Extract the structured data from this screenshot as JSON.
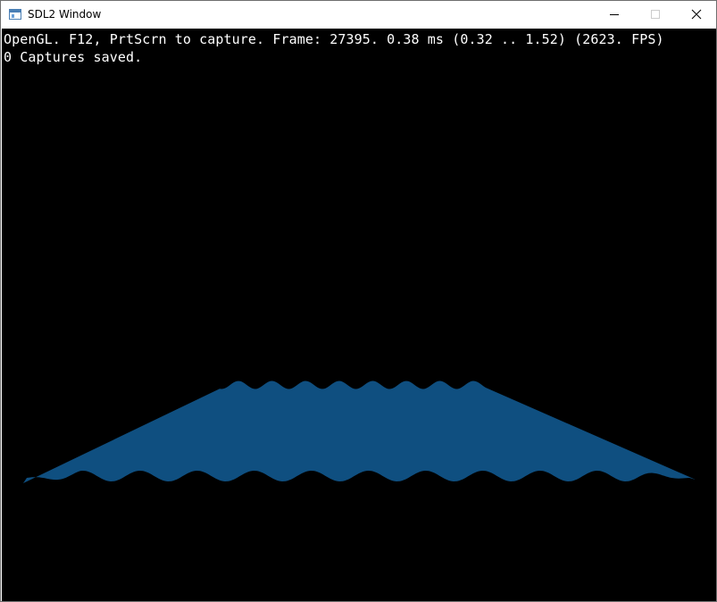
{
  "window": {
    "title": "SDL2 Window",
    "app_icon": "window-app-icon",
    "controls": {
      "minimize_icon": "minimize-icon",
      "maximize_icon": "maximize-icon",
      "close_icon": "close-icon"
    }
  },
  "overlay": {
    "status_line": "OpenGL. F12, PrtScrn to capture. Frame: 27395. 0.38 ms (0.32 .. 1.52) (2623. FPS)",
    "captures_line": "0 Captures saved."
  },
  "colors": {
    "canvas_background": "#000000",
    "shape_fill": "#0f4f80",
    "overlay_text": "#ffffff"
  }
}
